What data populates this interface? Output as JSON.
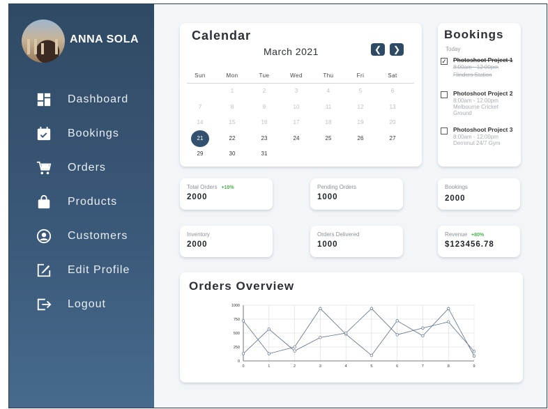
{
  "user": {
    "name": "ANNA SOLA"
  },
  "nav": [
    {
      "label": "Dashboard",
      "icon": "dashboard-icon"
    },
    {
      "label": "Bookings",
      "icon": "calendar-icon"
    },
    {
      "label": "Orders",
      "icon": "cart-icon"
    },
    {
      "label": "Products",
      "icon": "bag-icon"
    },
    {
      "label": "Customers",
      "icon": "user-circle-icon"
    },
    {
      "label": "Edit Profile",
      "icon": "edit-icon"
    },
    {
      "label": "Logout",
      "icon": "logout-icon"
    }
  ],
  "calendar": {
    "title": "Calendar",
    "month": "March 2021",
    "weekdays": [
      "Sun",
      "Mon",
      "Tue",
      "Wed",
      "Thu",
      "Fri",
      "Sat"
    ],
    "selected_day": "21",
    "weeks": [
      [
        "",
        "1",
        "2",
        "3",
        "4",
        "5",
        "6"
      ],
      [
        "7",
        "8",
        "9",
        "10",
        "11",
        "12",
        "13"
      ],
      [
        "14",
        "15",
        "16",
        "17",
        "18",
        "19",
        "20"
      ],
      [
        "21",
        "22",
        "23",
        "24",
        "25",
        "26",
        "27"
      ],
      [
        "29",
        "30",
        "31",
        "",
        "",
        "",
        ""
      ]
    ],
    "muted_before": 21
  },
  "bookings": {
    "title": "Bookings",
    "subtitle": "Today",
    "items": [
      {
        "name": "Photoshoot Project 1",
        "time": "8:00am - 12:00pm",
        "place": "Flinders Station",
        "checked": true
      },
      {
        "name": "Photoshoot Project 2",
        "time": "8:00am - 12:00pm",
        "place": "Melbourne Cricket Ground",
        "checked": false
      },
      {
        "name": "Photoshoot Project 3",
        "time": "8:00am - 12:00pm",
        "place": "Derrimut 24/7 Gym",
        "checked": false
      }
    ]
  },
  "stats": {
    "total_orders": {
      "label": "Total Orders",
      "badge": "+10%",
      "value": "2000"
    },
    "pending_orders": {
      "label": "Pending Orders",
      "value": "1000"
    },
    "bookings": {
      "label": "Bookings",
      "value": "2000"
    },
    "inventory": {
      "label": "Inventory",
      "value": "2000"
    },
    "orders_delivered": {
      "label": "Orders Delivered",
      "value": "1000"
    },
    "revenue": {
      "label": "Revenue",
      "badge": "+80%",
      "value": "$123456.78"
    }
  },
  "colors": {
    "sidebar": "#2f4a64",
    "accent": "#34506f",
    "positive": "#4bb04b",
    "line": "#5a6e84"
  },
  "chart_data": {
    "type": "line",
    "title": "Orders Overview",
    "x": [
      0,
      1,
      2,
      3,
      4,
      5,
      6,
      7,
      8,
      9
    ],
    "ylim": [
      0,
      1000
    ],
    "yticks": [
      0,
      250,
      500,
      750,
      1000
    ],
    "grid": true,
    "series": [
      {
        "values": [
          720,
          130,
          250,
          940,
          480,
          100,
          720,
          450,
          940,
          90
        ]
      },
      {
        "values": [
          130,
          570,
          180,
          420,
          500,
          940,
          470,
          590,
          700,
          170
        ]
      }
    ]
  }
}
